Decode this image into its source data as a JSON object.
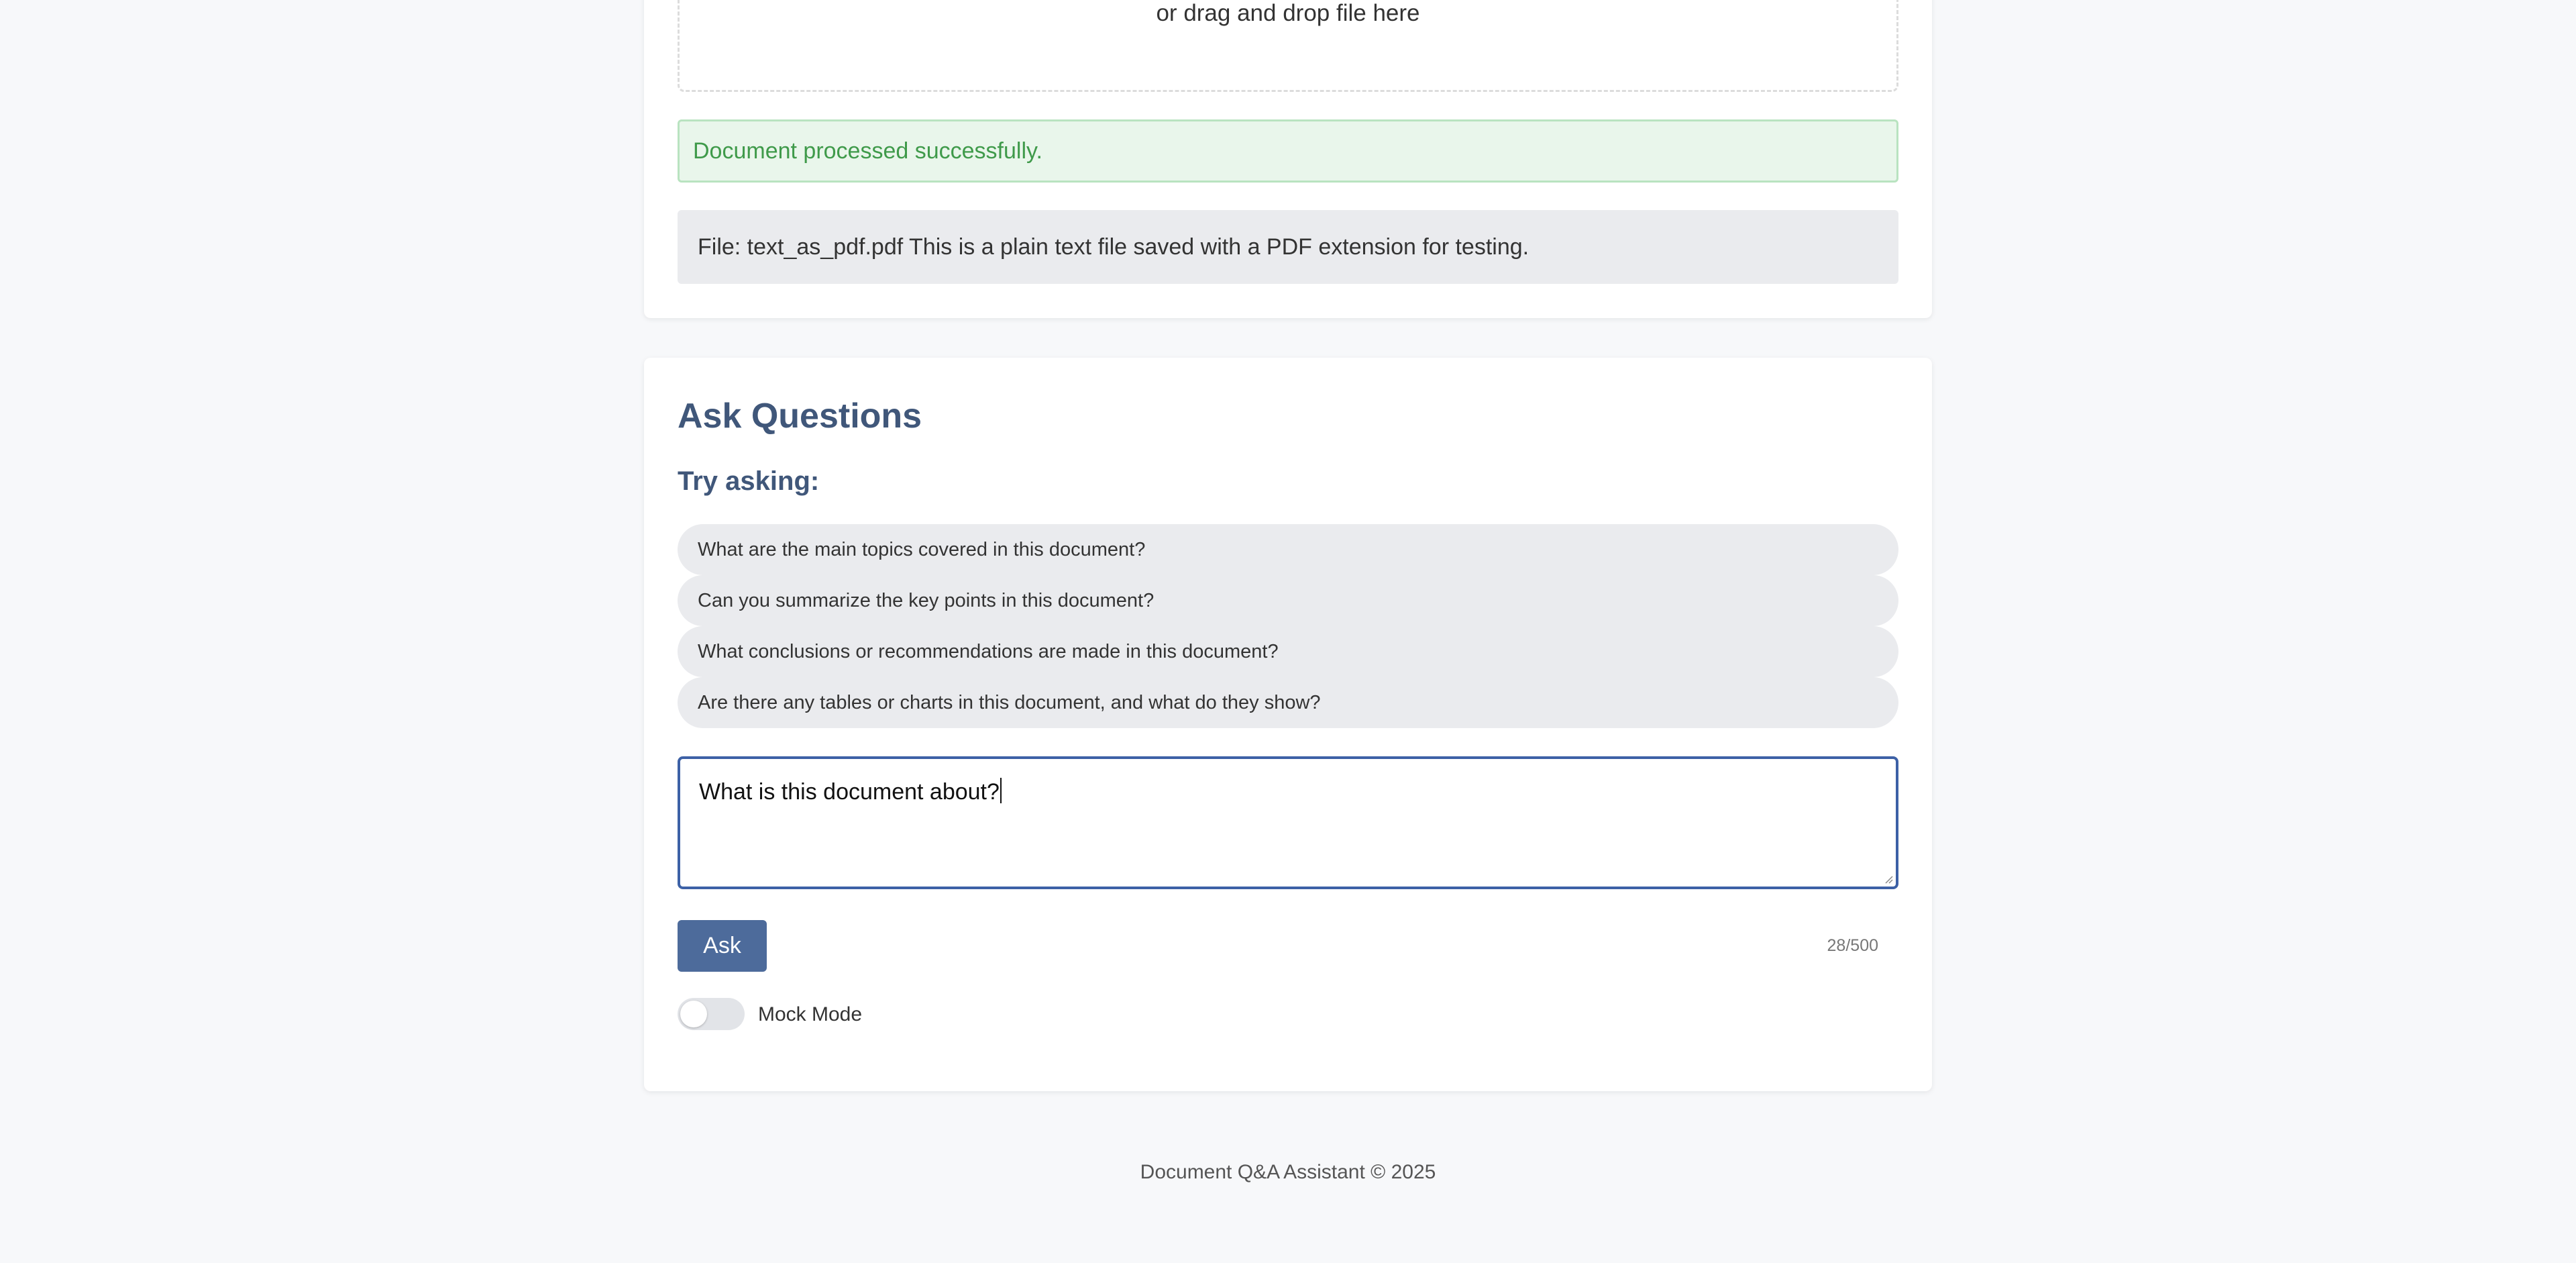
{
  "upload": {
    "drop_text": "or drag and drop file here",
    "success_message": "Document processed successfully.",
    "file_info": "File: text_as_pdf.pdf This is a plain text file saved with a PDF extension for testing."
  },
  "ask": {
    "title": "Ask Questions",
    "try_title": "Try asking:",
    "suggestions": [
      "What are the main topics covered in this document?",
      "Can you summarize the key points in this document?",
      "What conclusions or recommendations are made in this document?",
      "Are there any tables or charts in this document, and what do they show?"
    ],
    "question_value": "What is this document about?",
    "ask_label": "Ask",
    "char_count": "28/500",
    "mock_mode_label": "Mock Mode",
    "mock_mode_on": false
  },
  "footer": {
    "text": "Document Q&A Assistant © 2025"
  },
  "colors": {
    "accent": "#3d61a6",
    "button": "#4d6b9b",
    "heading": "#40577a",
    "success_text": "#3f9a4a",
    "success_bg": "#e9f6eb"
  }
}
